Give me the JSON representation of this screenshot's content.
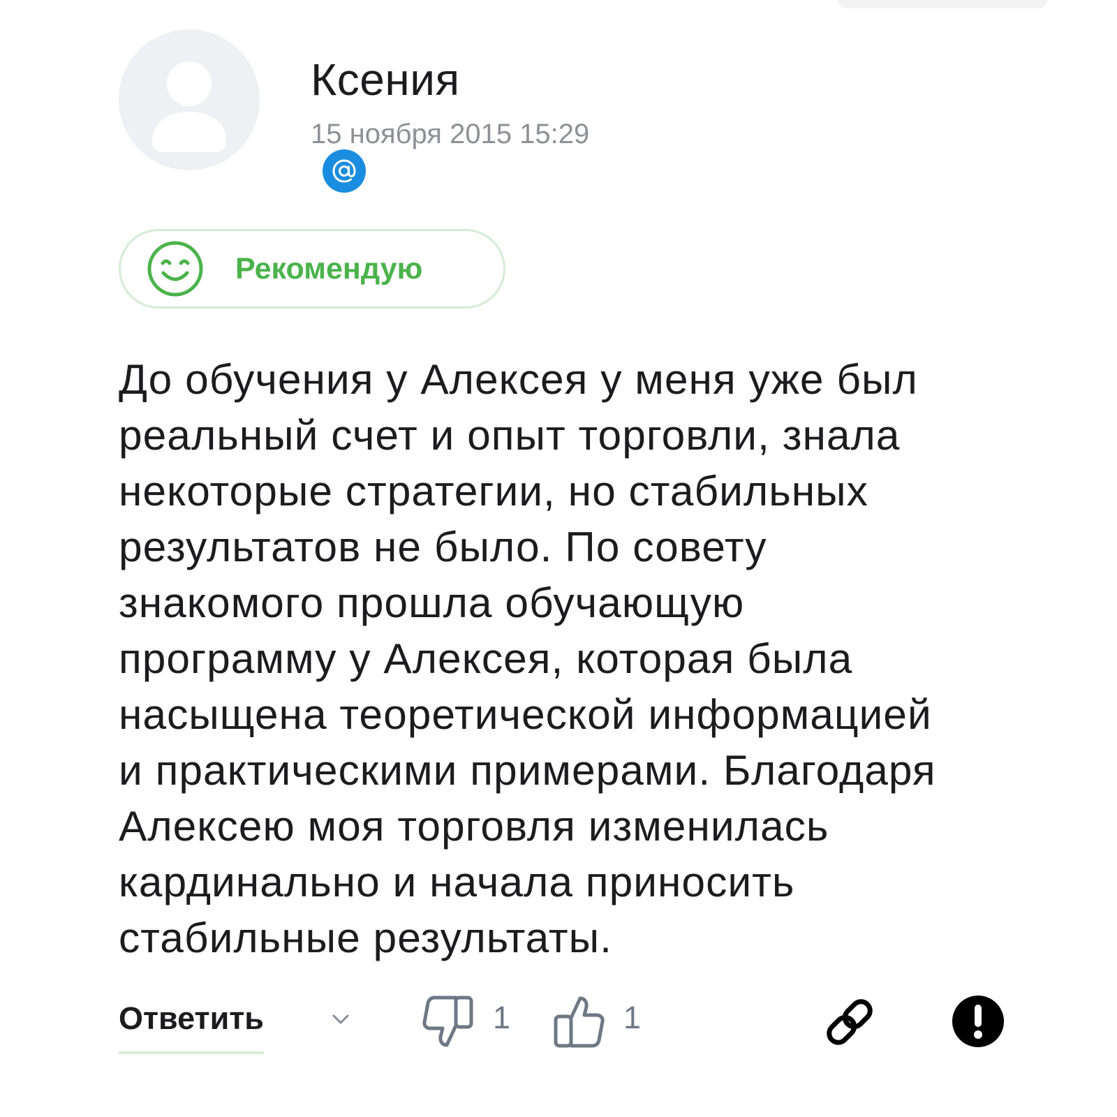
{
  "author": {
    "name": "Ксения",
    "avatar_icon": "user-placeholder-icon",
    "badge_icon": "mail-at-icon",
    "badge_color": "#1a8de0"
  },
  "post": {
    "date": "15 ноября 2015 15:29",
    "recommend_label": "Рекомендую",
    "recommend_icon": "smile-icon",
    "recommend_color": "#4bb34b",
    "text": "До обучения у Алексея у меня уже был\nреальный счет и опыт торговли, знала\nнекоторые стратегии, но стабильных\nрезультатов не было. По совету\nзнакомого прошла обучающую\nпрограмму у Алексея, которая была\nнасыщена теоретической информацией\nи практическими примерами. Благодаря\nАлексею моя торговля изменилась\nкардинально и начала приносить\nстабильные результаты."
  },
  "actions": {
    "reply_label": "Ответить",
    "dislike_count": "1",
    "like_count": "1",
    "icons": [
      "chevron-down-icon",
      "thumbs-down-icon",
      "thumbs-up-icon",
      "link-icon",
      "report-icon"
    ]
  }
}
